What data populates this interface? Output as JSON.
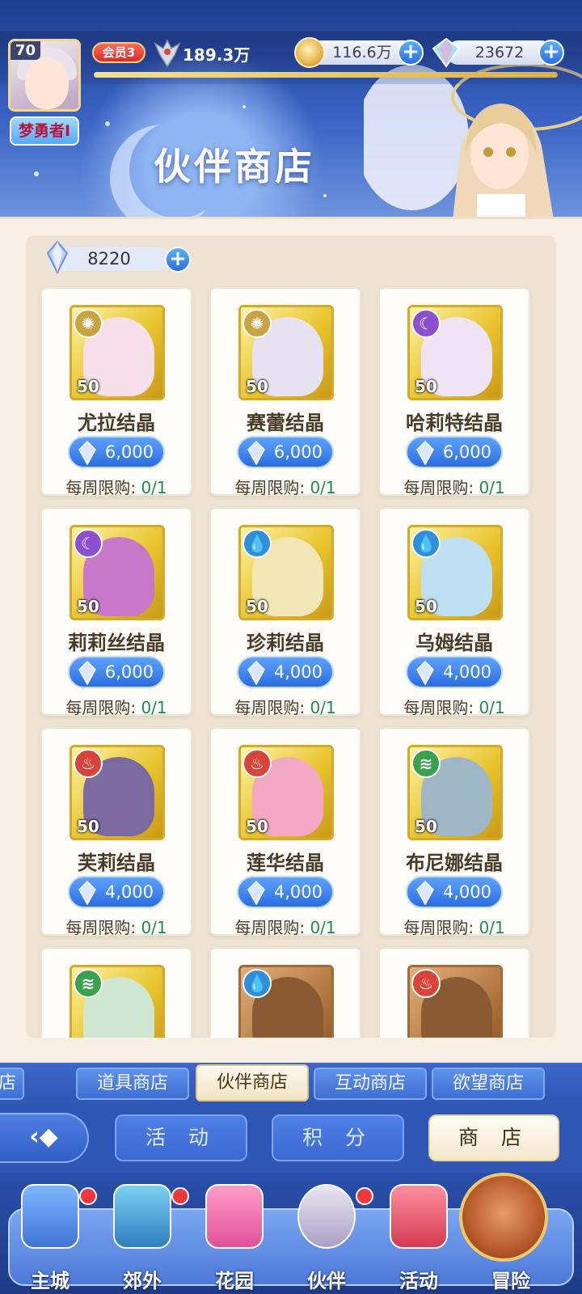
{
  "player": {
    "level": "70",
    "nickname": "梦勇者I",
    "vip": "会员3",
    "power": "189.3万"
  },
  "resources": {
    "gold": "116.6万",
    "gems": "23672",
    "crystal": "8220"
  },
  "page_title": "伙伴商店",
  "items": [
    {
      "name": "尤拉结晶",
      "price": "6,000",
      "qty": "50",
      "element": "sun",
      "limit_label": "每周限购:",
      "limit": "0/1",
      "frame": "gold",
      "tint": "#f6dfe8"
    },
    {
      "name": "赛蕾结晶",
      "price": "6,000",
      "qty": "50",
      "element": "sun",
      "limit_label": "每周限购:",
      "limit": "0/1",
      "frame": "gold",
      "tint": "#e7e2f2"
    },
    {
      "name": "哈莉特结晶",
      "price": "6,000",
      "qty": "50",
      "element": "moon",
      "limit_label": "每周限购:",
      "limit": "0/1",
      "frame": "gold",
      "tint": "#efe4f4"
    },
    {
      "name": "莉莉丝结晶",
      "price": "6,000",
      "qty": "50",
      "element": "moon",
      "limit_label": "每周限购:",
      "limit": "0/1",
      "frame": "gold",
      "tint": "#c778c8"
    },
    {
      "name": "珍莉结晶",
      "price": "4,000",
      "qty": "50",
      "element": "water",
      "limit_label": "每周限购:",
      "limit": "0/1",
      "frame": "gold",
      "tint": "#f3e6b6"
    },
    {
      "name": "乌姆结晶",
      "price": "4,000",
      "qty": "50",
      "element": "water",
      "limit_label": "每周限购:",
      "limit": "0/1",
      "frame": "gold",
      "tint": "#bfe0f2"
    },
    {
      "name": "芙莉结晶",
      "price": "4,000",
      "qty": "50",
      "element": "fire",
      "limit_label": "每周限购:",
      "limit": "0/1",
      "frame": "gold",
      "tint": "#7b6aa0"
    },
    {
      "name": "莲华结晶",
      "price": "4,000",
      "qty": "50",
      "element": "fire",
      "limit_label": "每周限购:",
      "limit": "0/1",
      "frame": "gold",
      "tint": "#f3a9c4"
    },
    {
      "name": "布尼娜结晶",
      "price": "4,000",
      "qty": "50",
      "element": "wind",
      "limit_label": "每周限购:",
      "limit": "0/1",
      "frame": "gold",
      "tint": "#9fb7c6"
    },
    {
      "name": "",
      "price": "",
      "qty": "",
      "element": "wind",
      "limit_label": "",
      "limit": "",
      "frame": "gold",
      "tint": "#cfe6d0"
    },
    {
      "name": "",
      "price": "",
      "qty": "",
      "element": "water",
      "limit_label": "",
      "limit": "",
      "frame": "bronze",
      "tint": "#8a5a34"
    },
    {
      "name": "",
      "price": "",
      "qty": "",
      "element": "fire",
      "limit_label": "",
      "limit": "",
      "frame": "bronze",
      "tint": "#8a5a34"
    }
  ],
  "elements": {
    "sun": {
      "glyph": "✺",
      "color": "#c9a440"
    },
    "moon": {
      "glyph": "☾",
      "color": "#8b4fd0"
    },
    "water": {
      "glyph": "💧",
      "color": "#2f8fd8"
    },
    "fire": {
      "glyph": "♨",
      "color": "#d8443a"
    },
    "wind": {
      "glyph": "≋",
      "color": "#3aa24e"
    }
  },
  "shop_tabs": [
    "店",
    "道具商店",
    "伙伴商店",
    "互动商店",
    "欲望商店"
  ],
  "active_tab": "伙伴商店",
  "sub_nav": {
    "back": "‹◆",
    "activity": "活 动",
    "points": "积 分",
    "shop": "商 店"
  },
  "bottom_nav": [
    {
      "label": "主城",
      "dot": true
    },
    {
      "label": "郊外",
      "dot": true
    },
    {
      "label": "花园",
      "dot": false
    },
    {
      "label": "伙伴",
      "dot": true
    },
    {
      "label": "活动",
      "dot": false
    },
    {
      "label": "冒险",
      "dot": false
    }
  ]
}
